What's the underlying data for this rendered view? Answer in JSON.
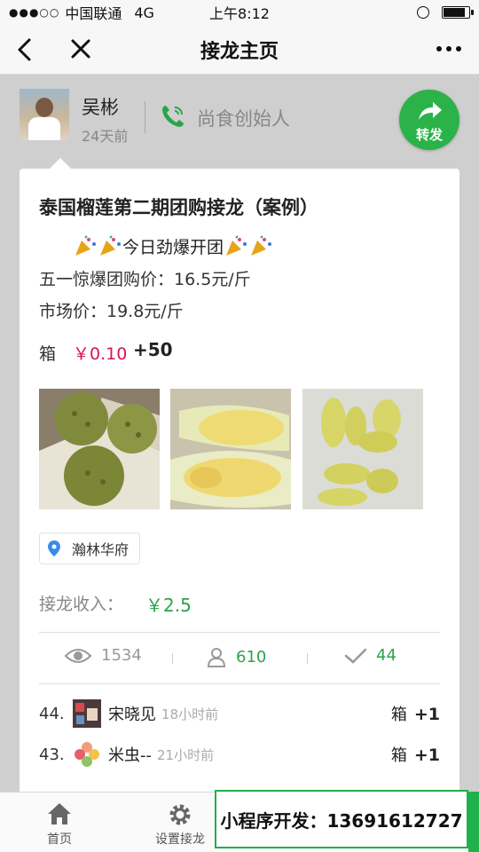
{
  "status_bar": {
    "signal": "●●●○○",
    "carrier": "中国联通",
    "network": "4G",
    "time": "上午8:12",
    "battery_percent": 88
  },
  "nav": {
    "title": "接龙主页"
  },
  "header": {
    "author_name": "吴彬",
    "author_time": "24天前",
    "founder_label": "尚食创始人",
    "share_label": "转发"
  },
  "post": {
    "title": "泰国榴莲第二期团购接龙（案例）",
    "promo": "今日劲爆开团",
    "price_line": "五一惊爆团购价：16.5元/斤",
    "market_line": "市场价：19.8元/斤",
    "box_label": "箱",
    "unit_price": "￥0.10",
    "quantity": "+50",
    "location": "瀚林华府",
    "income_label": "接龙收入：",
    "income_value": "￥2.5"
  },
  "stats": {
    "views": "1534",
    "participants": "610",
    "completed": "44"
  },
  "entries": [
    {
      "idx": "44.",
      "name": "宋晓见",
      "time": "18小时前",
      "unit": "箱",
      "qty": "+1"
    },
    {
      "idx": "43.",
      "name": "米虫--",
      "time": "21小时前",
      "unit": "箱",
      "qty": "+1"
    }
  ],
  "tabs": {
    "home": "首页",
    "settings": "设置接龙"
  },
  "ad_text": "小程序开发：13691612727",
  "colors": {
    "accent_green": "#2bb34a",
    "price_red": "#d4145a",
    "income_green": "#2aa44a"
  }
}
